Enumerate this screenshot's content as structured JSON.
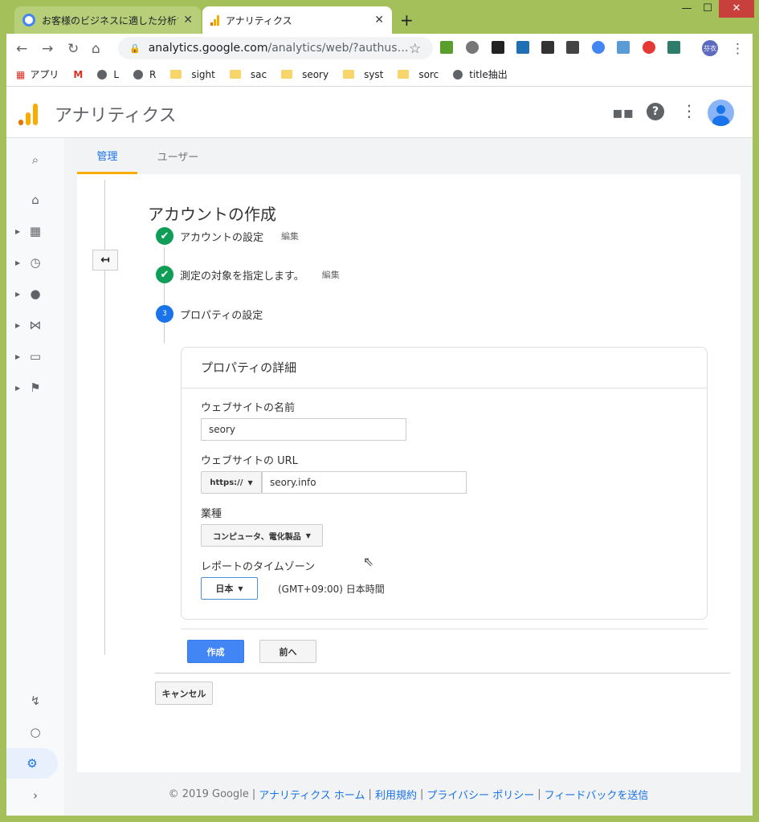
{
  "browser": {
    "tabs": [
      {
        "title": "お客様のビジネスに適した分析ツール -",
        "active": false
      },
      {
        "title": "アナリティクス",
        "active": true
      }
    ],
    "new_tab": "+",
    "window_controls": {
      "minimize": "—",
      "maximize": "☐",
      "close": "✕"
    },
    "url_host": "analytics.google.com",
    "url_path": "/analytics/web/?authus…",
    "bookmarks": [
      {
        "label": "アプリ",
        "icon": "apps-grid-icon"
      },
      {
        "label": "",
        "icon": "gmail-icon"
      },
      {
        "label": "L",
        "icon": "globe-icon"
      },
      {
        "label": "R",
        "icon": "globe-icon"
      },
      {
        "label": "sight",
        "icon": "folder-icon"
      },
      {
        "label": "sac",
        "icon": "folder-icon"
      },
      {
        "label": "seory",
        "icon": "folder-icon"
      },
      {
        "label": "syst",
        "icon": "folder-icon"
      },
      {
        "label": "sorc",
        "icon": "folder-icon"
      },
      {
        "label": "title抽出",
        "icon": "globe-icon"
      }
    ],
    "profile_initials": "芬衣"
  },
  "app": {
    "title": "アナリティクス"
  },
  "tabs": [
    {
      "label": "管理",
      "active": true
    },
    {
      "label": "ユーザー",
      "active": false
    }
  ],
  "wizard": {
    "title": "アカウントの作成",
    "steps": [
      {
        "label": "アカウントの設定",
        "edit": "編集",
        "status": "done"
      },
      {
        "label": "測定の対象を指定します。",
        "edit": "編集",
        "status": "done"
      },
      {
        "label": "プロパティの設定",
        "number": "3",
        "status": "current"
      }
    ],
    "panel_title": "プロパティの詳細",
    "site_name_label": "ウェブサイトの名前",
    "site_name_value": "seory",
    "url_label": "ウェブサイトの URL",
    "protocol": "https://",
    "url_value": "seory.info",
    "industry_label": "業種",
    "industry_value": "コンピュータ、電化製品",
    "timezone_label": "レポートのタイムゾーン",
    "country_value": "日本",
    "timezone_value": "(GMT+09:00) 日本時間",
    "create_button": "作成",
    "prev_button": "前へ",
    "cancel_button": "キャンセル"
  },
  "footer": {
    "copyright": "© 2019 Google",
    "links": [
      "アナリティクス ホーム",
      "利用規約",
      "プライバシー ポリシー",
      "フィードバックを送信"
    ]
  },
  "colors": {
    "accent": "#1a73e8",
    "create_button": "#4285f4",
    "step_done": "#0f9d58",
    "step_current": "#1a73e8",
    "window_frame": "#a4c05a",
    "logo_orange": "#f9ab00",
    "logo_dark": "#e37400"
  }
}
